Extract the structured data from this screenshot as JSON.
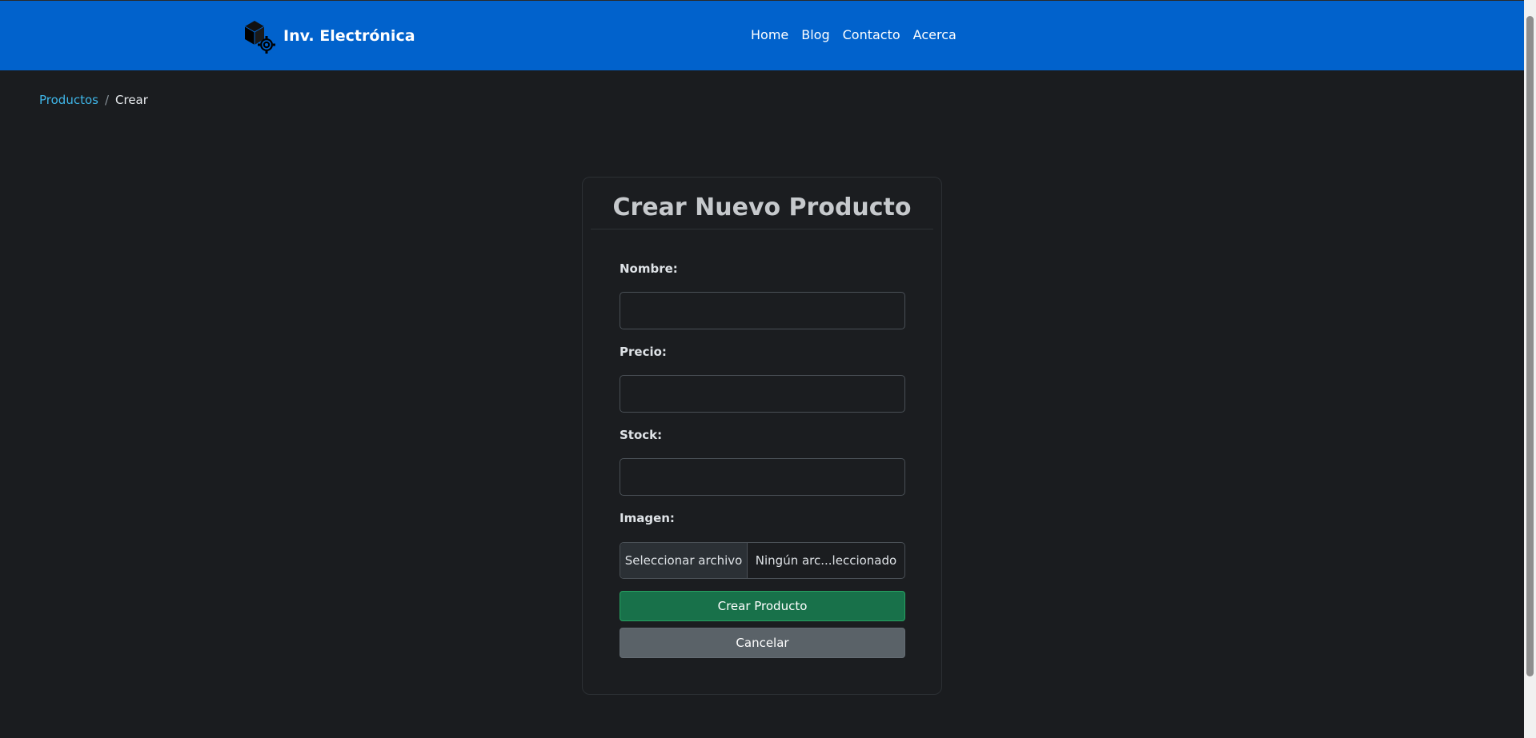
{
  "brand": {
    "name": "Inv. Electrónica",
    "icon": "box-gear-icon"
  },
  "nav": {
    "links": [
      "Home",
      "Blog",
      "Contacto",
      "Acerca"
    ]
  },
  "breadcrumb": {
    "parent": "Productos",
    "separator": "/",
    "current": "Crear"
  },
  "form": {
    "title": "Crear Nuevo Producto",
    "fields": {
      "nombre": {
        "label": "Nombre:",
        "value": ""
      },
      "precio": {
        "label": "Precio:",
        "value": ""
      },
      "stock": {
        "label": "Stock:",
        "value": ""
      },
      "imagen": {
        "label": "Imagen:",
        "button": "Seleccionar archivo",
        "file_name": "Ningún arc...leccionado"
      }
    },
    "submit_label": "Crear Producto",
    "cancel_label": "Cancelar"
  },
  "colors": {
    "navbar": "#0162cc",
    "background": "#1a1c1f",
    "success": "#18714a",
    "secondary": "#5a6268",
    "link": "#3fb6e8"
  }
}
